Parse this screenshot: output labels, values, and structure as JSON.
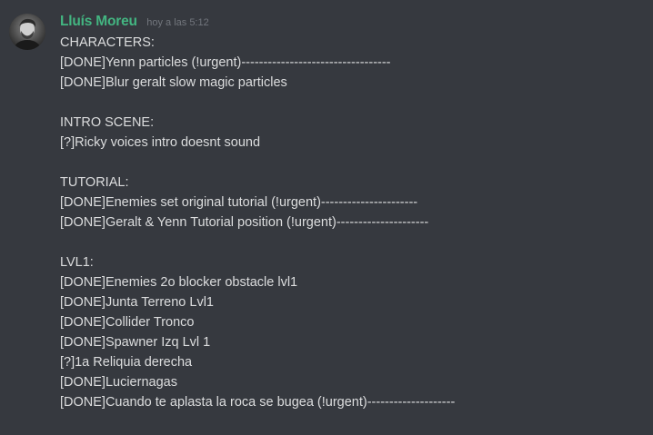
{
  "message": {
    "author": "Lluís Moreu",
    "timestamp": "hoy a las 5:12",
    "lines": [
      "CHARACTERS:",
      "[DONE]Yenn particles (!urgent)----------------------------------",
      "[DONE]Blur geralt slow magic particles",
      "",
      "INTRO SCENE:",
      "[?]Ricky voices intro doesnt sound",
      "",
      "TUTORIAL:",
      "[DONE]Enemies set original tutorial (!urgent)----------------------",
      "[DONE]Geralt & Yenn Tutorial position (!urgent)---------------------",
      "",
      "LVL1:",
      "[DONE]Enemies 2o blocker obstacle lvl1",
      "[DONE]Junta Terreno Lvl1",
      "[DONE]Collider Tronco",
      "[DONE]Spawner Izq Lvl 1",
      "[?]1a Reliquia derecha",
      "[DONE]Luciernagas",
      "[DONE]Cuando te aplasta la roca se bugea (!urgent)--------------------"
    ]
  },
  "colors": {
    "background": "#36393f",
    "username": "#43b581",
    "text": "#dcddde",
    "timestamp": "#72767d"
  }
}
